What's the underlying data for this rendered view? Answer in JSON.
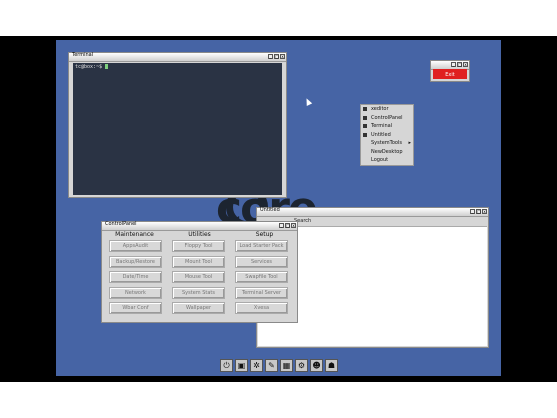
{
  "terminal": {
    "title": "Terminal",
    "prompt": "tc@box:~$"
  },
  "context_menu": {
    "items": [
      {
        "label": "xeditor"
      },
      {
        "label": "ControlPanel"
      },
      {
        "label": "Terminal"
      },
      {
        "label": "Untitled"
      },
      {
        "label": "SystemTools",
        "submenu_arrow": "▸"
      },
      {
        "label": "NewDesktop"
      },
      {
        "label": "Logout"
      }
    ]
  },
  "untitled": {
    "title": "Untitled",
    "search_label": "Search"
  },
  "red_window": {
    "label": "Exit"
  },
  "controlpanel": {
    "title": "ControlPanel",
    "tabs": [
      "Maintenance",
      "Utilities",
      "Setup"
    ],
    "maintenance": [
      "AppsAudit",
      "Backup/Restore",
      "Date/Time",
      "Network",
      "Wbar Conf"
    ],
    "utilities": [
      "Floppy Tool",
      "Mount Tool",
      "Mouse Tool",
      "System Stats",
      "Wallpaper"
    ],
    "setup": [
      "Load Starter Pack",
      "Services",
      "Swapfile Tool",
      "Terminal Server",
      "Xvesa"
    ]
  },
  "desktop_logo": "core",
  "taskbar": {
    "icons": [
      "power-icon",
      "terminal-icon",
      "settings-icon",
      "editor-icon",
      "apps-icon",
      "tools-icon",
      "mount-icon",
      "network-icon"
    ],
    "glyphs": [
      "⏻",
      "▣",
      "✲",
      "✎",
      "▦",
      "⚙",
      "☻",
      "☗"
    ]
  },
  "colors": {
    "desktop": "#4664a5",
    "terminal_bg": "#2a3344",
    "exit_red": "#e02020"
  }
}
